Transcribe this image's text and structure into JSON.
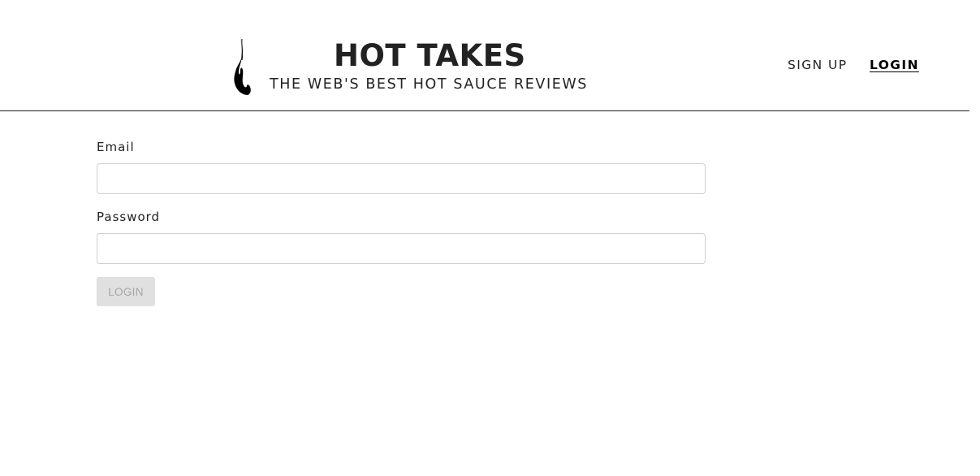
{
  "header": {
    "logo_icon": "flame-icon",
    "title": "HOT TAKES",
    "subtitle": "THE WEB'S BEST HOT SAUCE REVIEWS",
    "nav": {
      "signup_label": "SIGN UP",
      "login_label": "LOGIN"
    }
  },
  "form": {
    "email": {
      "label": "Email",
      "value": "",
      "placeholder": ""
    },
    "password": {
      "label": "Password",
      "value": "",
      "placeholder": ""
    },
    "submit_label": "LOGIN",
    "submit_disabled": true
  },
  "colors": {
    "text": "#222222",
    "divider": "#1a1a1a",
    "input_border": "#cfcfcf",
    "button_disabled_bg": "#e0e0e0",
    "button_disabled_text": "#a6a6a6"
  }
}
